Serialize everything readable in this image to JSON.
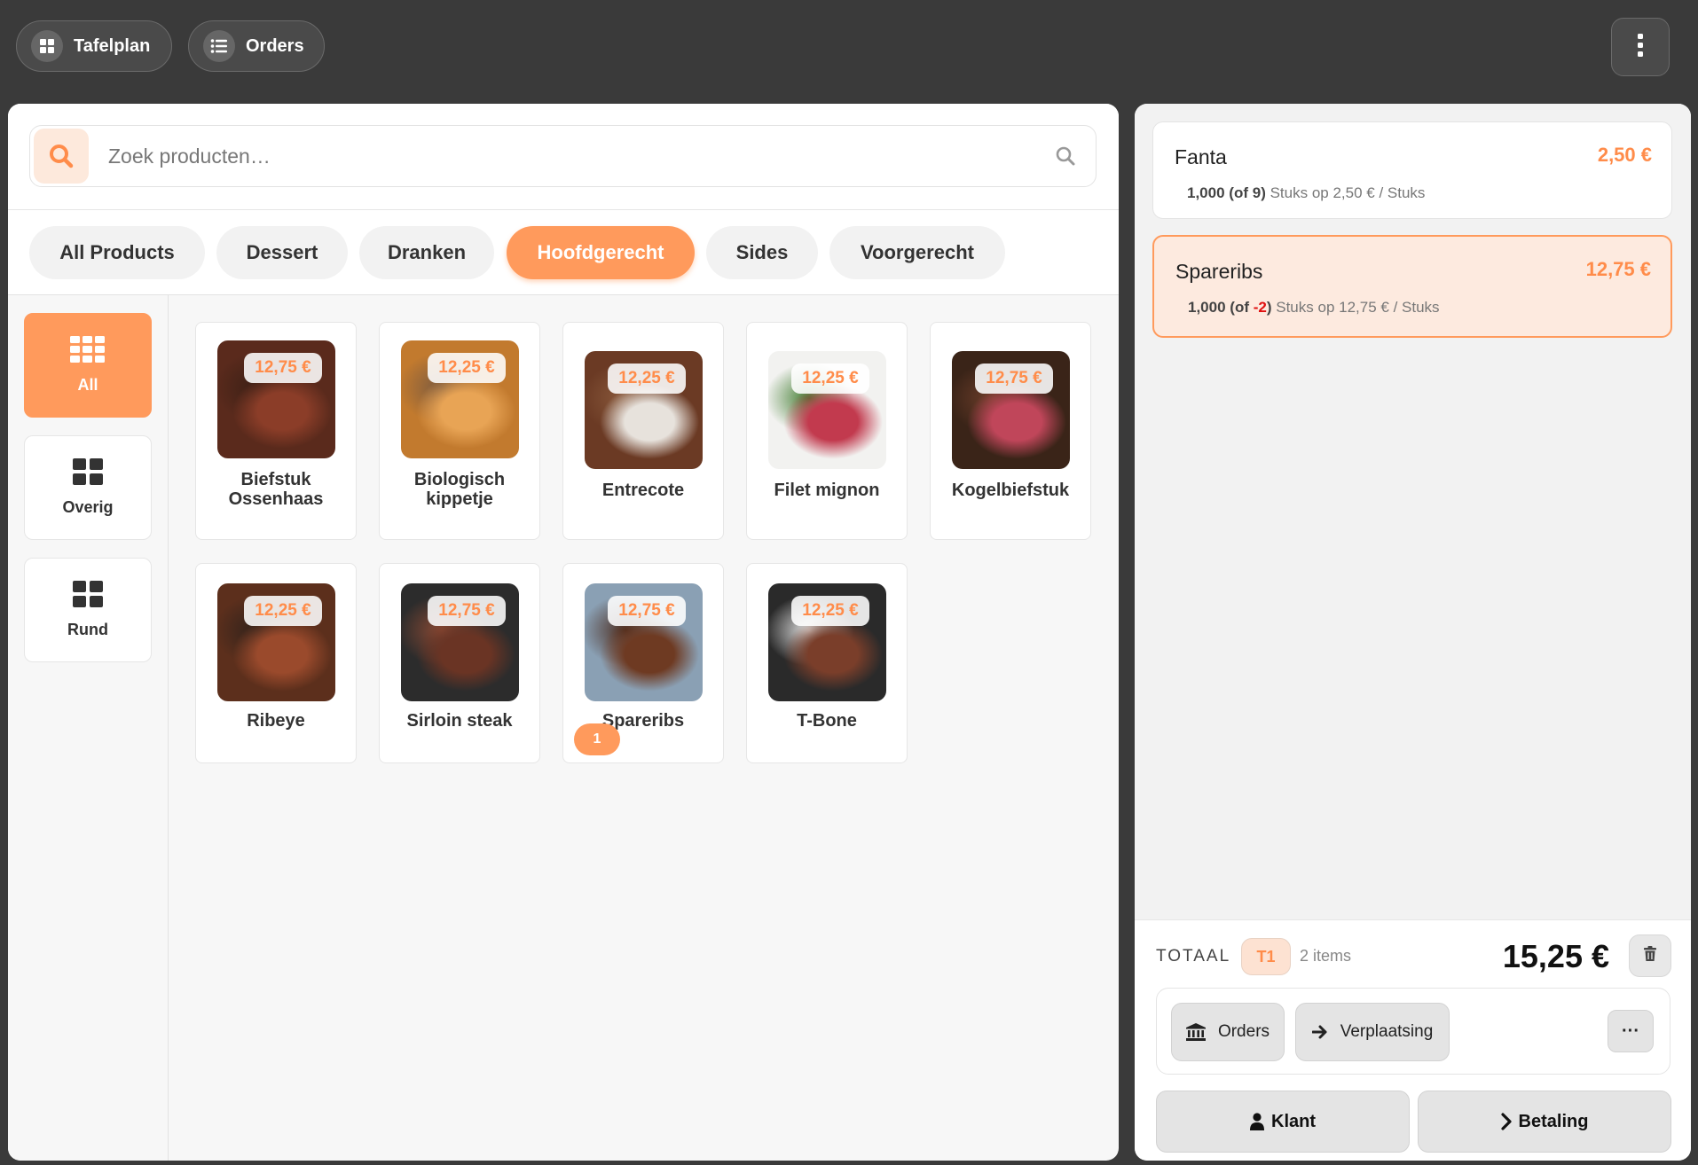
{
  "topbar": {
    "tafelplan_label": "Tafelplan",
    "orders_label": "Orders"
  },
  "search": {
    "placeholder": "Zoek producten…"
  },
  "categories": [
    {
      "label": "All Products",
      "active": false
    },
    {
      "label": "Dessert",
      "active": false
    },
    {
      "label": "Dranken",
      "active": false
    },
    {
      "label": "Hoofdgerecht",
      "active": true
    },
    {
      "label": "Sides",
      "active": false
    },
    {
      "label": "Voorgerecht",
      "active": false
    }
  ],
  "subcategories": [
    {
      "label": "All",
      "active": true
    },
    {
      "label": "Overig",
      "active": false
    },
    {
      "label": "Rund",
      "active": false
    }
  ],
  "products": [
    {
      "name_line1": "Biefstuk",
      "name_line2": "Ossenhaas",
      "price": "12,75 €",
      "colors": [
        "#5a2a1c",
        "#8b3d28",
        "#3b2016"
      ]
    },
    {
      "name_line1": "Biologisch",
      "name_line2": "kippetje",
      "price": "12,25 €",
      "colors": [
        "#c27a2e",
        "#e8a455",
        "#7a5a40"
      ]
    },
    {
      "name_line1": "Entrecote",
      "name_line2": "",
      "price": "12,25 €",
      "colors": [
        "#6b3a24",
        "#e7e2dc",
        "#8a5a3c"
      ]
    },
    {
      "name_line1": "Filet mignon",
      "name_line2": "",
      "price": "12,25 €",
      "colors": [
        "#f2f2f0",
        "#c23a4e",
        "#3d7a2c"
      ]
    },
    {
      "name_line1": "Kogelbiefstuk",
      "name_line2": "",
      "price": "12,75 €",
      "colors": [
        "#3a2418",
        "#c0465a",
        "#6e3e2a"
      ]
    },
    {
      "name_line1": "Ribeye",
      "name_line2": "",
      "price": "12,25 €",
      "colors": [
        "#5c2f1c",
        "#9a4a2c",
        "#2f221b"
      ]
    },
    {
      "name_line1": "Sirloin steak",
      "name_line2": "",
      "price": "12,75 €",
      "colors": [
        "#2c2c2c",
        "#6a3424",
        "#8c4a34"
      ]
    },
    {
      "name_line1": "Spareribs",
      "name_line2": "",
      "price": "12,75 €",
      "colors": [
        "#8aa0b4",
        "#6e3a22",
        "#4a2a1c"
      ],
      "badge": "1"
    },
    {
      "name_line1": "T-Bone",
      "name_line2": "",
      "price": "12,25 €",
      "colors": [
        "#2a2a2a",
        "#7a3e2a",
        "#e8e8e8"
      ]
    }
  ],
  "order": {
    "lines": [
      {
        "name": "Fanta",
        "price": "2,50 €",
        "qty": "1,000",
        "of_prefix": "(of ",
        "of_value": "9",
        "of_suffix": ")",
        "detail": "Stuks op 2,50 € / Stuks",
        "negative": false
      },
      {
        "name": "Spareribs",
        "price": "12,75 €",
        "qty": "1,000",
        "of_prefix": "(of ",
        "of_value": "-2",
        "of_suffix": ")",
        "detail": "Stuks op 12,75 € / Stuks",
        "negative": true
      }
    ],
    "total_label": "TOTAAL",
    "table": "T1",
    "items_count": "2 items",
    "total_amount": "15,25 €",
    "orders_label": "Orders",
    "move_label": "Verplaatsing",
    "more_label": "···",
    "customer_label": "Klant",
    "payment_label": "Betaling"
  }
}
